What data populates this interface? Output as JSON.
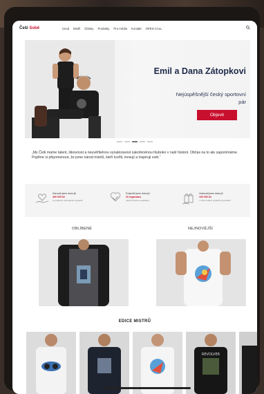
{
  "header": {
    "logo_main": "Češi",
    "logo_accent": "Sobě",
    "nav": [
      "Úvod",
      "Mistři",
      "Články",
      "Produkty",
      "Pro média",
      "Kontakt",
      "OPEN CALL"
    ]
  },
  "hero": {
    "title": "Emil a Dana Zátopkovi",
    "subtitle": "Nejúspěšnější český sportovní pár",
    "cta": "Objevit"
  },
  "quote": "„My Češi máme talent, šikovnost a neuvěřitelnou vynalézavost zakořeněnou hluboko v naší historii. Občas na to ale zapomínáme. Pojďme si připomenout, že jsme národ mistrů, kteří tvořili, inovují a inspirují svět.“",
  "features": [
    {
      "icon": "heart-hand-icon",
      "line1": "Darovali jsme dnes již",
      "line2": "400 000 Kč",
      "line3": "na podporu začínajících projektů"
    },
    {
      "icon": "handshake-icon",
      "line1": "Podpořili jsme dnes již",
      "line2": "20 organizací",
      "line3": "napříč Českou republikou"
    },
    {
      "icon": "gift-icon",
      "line1": "Vratovali jsme dnes již",
      "line2": "100 000 let",
      "line3": "v rámci našich projektů a produktů"
    }
  ],
  "sections": {
    "favorites": "OBLÍBENÉ",
    "newest": "NEJNOVĚJŠÍ",
    "masters": "EDICE MISTRŮ"
  },
  "products": {
    "edice_shirt_text": "REVOLVER"
  },
  "colors": {
    "accent": "#c8102e",
    "navy": "#1e2a4a"
  }
}
